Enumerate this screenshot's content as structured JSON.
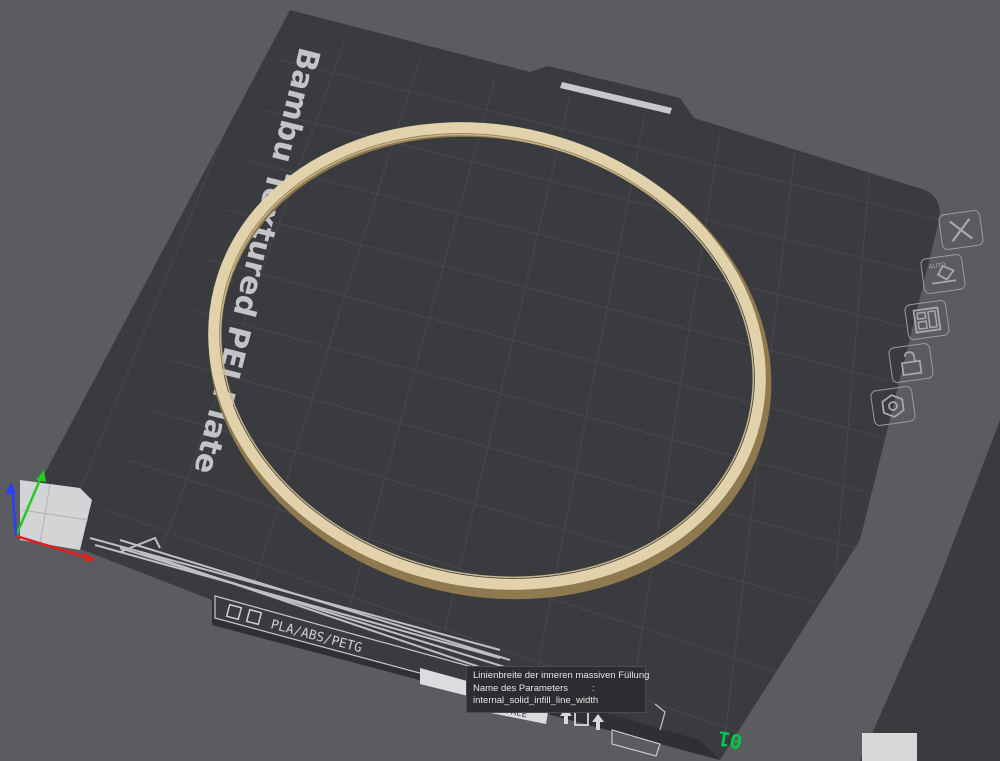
{
  "plate": {
    "name": "Bambu Textured PEI Plate",
    "filament_label": "PLA/ABS/PETG",
    "surface_label": "RFACE",
    "number": "01"
  },
  "toolbar": {
    "buttons": [
      {
        "id": "close",
        "icon": "close-icon"
      },
      {
        "id": "auto-orient",
        "icon": "auto-orient-icon",
        "label": "AUTO"
      },
      {
        "id": "arrange",
        "icon": "arrange-icon"
      },
      {
        "id": "lock",
        "icon": "unlock-icon"
      },
      {
        "id": "settings",
        "icon": "plate-settings-icon"
      }
    ]
  },
  "tooltip": {
    "line1": "Linienbreite der inneren massiven Füllung",
    "line2_label": "Name des Parameters",
    "line2_sep": ":",
    "line3": "internal_solid_infill_line_width"
  },
  "colors": {
    "background": "#5b5c60",
    "plate": "#3a3b3f",
    "ring": "#e2d2ac",
    "axis_x": "#e02020",
    "axis_y": "#22cc22",
    "axis_z": "#2a40ff",
    "plate_number": "#00c84a"
  }
}
